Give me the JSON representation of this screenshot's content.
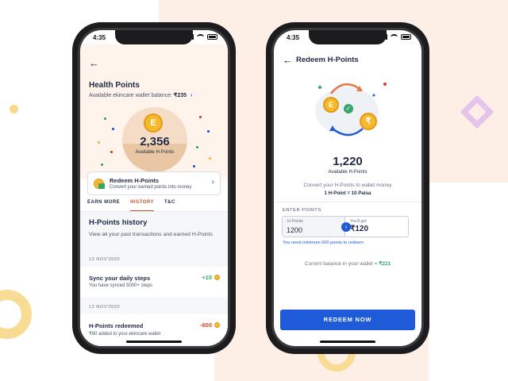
{
  "colors": {
    "primary_blue": "#1f5bd8",
    "positive_green": "#3aa56b",
    "negative_red": "#d6402b",
    "active_tab": "#c4542a",
    "coin_gold": "#f6b92c"
  },
  "left_screen": {
    "status_time": "4:35",
    "title": "Health Points",
    "wallet_label": "Available ekincare wallet balance: ",
    "wallet_amount": "₹235",
    "points_value": "2,356",
    "points_label": "Available H-Points",
    "coin_glyph": "E",
    "redeem_card": {
      "title": "Redeem H-Points",
      "subtitle": "Convert your earned points into money"
    },
    "tabs": [
      {
        "label": "EARN MORE",
        "active": false
      },
      {
        "label": "HISTORY",
        "active": true
      },
      {
        "label": "T&C",
        "active": false
      }
    ],
    "history_title": "H-Points history",
    "history_desc": "View all your past transactions and earned H-Points",
    "history": [
      {
        "date": "12 NOV'2020",
        "title": "Sync your daily steps",
        "subtitle": "You have synced 5000+ steps",
        "amount": "+10"
      },
      {
        "date": "12 NOV'2020",
        "title": "H-Points redeemed",
        "subtitle": "₹60 added to your ekincare wallet",
        "amount": "-600"
      }
    ]
  },
  "right_screen": {
    "status_time": "4:35",
    "title": "Redeem H-Points",
    "coin_glyph": "E",
    "rupee_glyph": "₹",
    "points_value": "1,220",
    "points_label": "Available H-Points",
    "convert_text": "Convert your H-Points to wallet money",
    "rate_text": "1 H-Point = 10 Paisa",
    "enter_label": "ENTER POINTS",
    "hpoints_caption": "H-Points",
    "hpoints_value": "1200",
    "youll_get_caption": "You'll get",
    "youll_get_value": "₹120",
    "min_note": "You need minimum 500 points to redeem",
    "balance_text": "Current balance in your wallet = ",
    "balance_amount": "₹221",
    "redeem_button": "REDEEM NOW"
  }
}
